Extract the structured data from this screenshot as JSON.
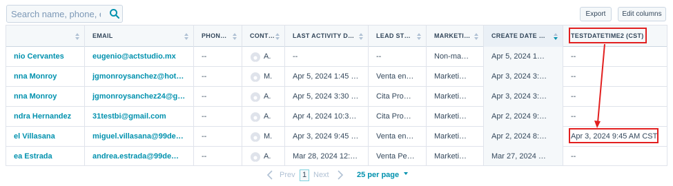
{
  "toolbar": {
    "search_placeholder": "Search name, phone, er",
    "export_label": "Export",
    "edit_columns_label": "Edit columns"
  },
  "columns": [
    "",
    "EMAIL",
    "PHON…",
    "CONT…",
    "LAST ACTIVITY D…",
    "LEAD ST…",
    "MARKETI…",
    "CREATE DATE …",
    "TESTDATETIME2 (CST)"
  ],
  "rows": [
    {
      "name": "nio Cervantes",
      "email": "eugenio@actstudio.mx",
      "phone": "--",
      "contact_initial": "A.",
      "last_activity": "--",
      "lead_status": "--",
      "marketing": "Non-ma…",
      "create_date": "Apr 5, 2024 1…",
      "testdatetime2": "--"
    },
    {
      "name": "nna Monroy",
      "email": "jgmonroysanchez@hot…",
      "phone": "--",
      "contact_initial": "M.",
      "last_activity": "Apr 5, 2024 1:45 …",
      "lead_status": "Venta en…",
      "marketing": "Marketi…",
      "create_date": "Apr 3, 2024 3:…",
      "testdatetime2": "--"
    },
    {
      "name": "nna Monroy",
      "email": "jgmonroysanchez24@g…",
      "phone": "--",
      "contact_initial": "A.",
      "last_activity": "Apr 5, 2024 3:30 …",
      "lead_status": "Cita Pro…",
      "marketing": "Marketi…",
      "create_date": "Apr 3, 2024 3:…",
      "testdatetime2": "--"
    },
    {
      "name": "ndra Hernandez",
      "email": "31testbi@gmail.com",
      "phone": "--",
      "contact_initial": "A.",
      "last_activity": "Apr 4, 2024 10:3…",
      "lead_status": "Cita Pro…",
      "marketing": "Marketi…",
      "create_date": "Apr 2, 2024 9:…",
      "testdatetime2": "--"
    },
    {
      "name": "el Villasana",
      "email": "miguel.villasana@99de…",
      "phone": "--",
      "contact_initial": "M.",
      "last_activity": "Apr 3, 2024 9:45 …",
      "lead_status": "Venta en…",
      "marketing": "Marketi…",
      "create_date": "Apr 2, 2024 8:…",
      "testdatetime2": "Apr 3, 2024 9:45 AM CST"
    },
    {
      "name": "ea Estrada",
      "email": "andrea.estrada@99de…",
      "phone": "--",
      "contact_initial": "A.",
      "last_activity": "Mar 28, 2024 12:…",
      "lead_status": "Venta Pe…",
      "marketing": "Marketi…",
      "create_date": "Mar 27, 2024 …",
      "testdatetime2": "--"
    }
  ],
  "pagination": {
    "prev_label": "Prev",
    "current_page": "1",
    "next_label": "Next",
    "page_size_label": "25 per page"
  },
  "icons": {
    "search": "search-icon",
    "sort": "sort-icon",
    "avatar": "avatar-icon",
    "prev": "chevron-left-icon",
    "next": "chevron-right-icon",
    "dropdown": "caret-down-icon"
  },
  "colors": {
    "link": "#0091ae",
    "text": "#33475b",
    "header_bg": "#f5f8fa",
    "border": "#dfe3eb",
    "annotation": "#e21f1f"
  }
}
